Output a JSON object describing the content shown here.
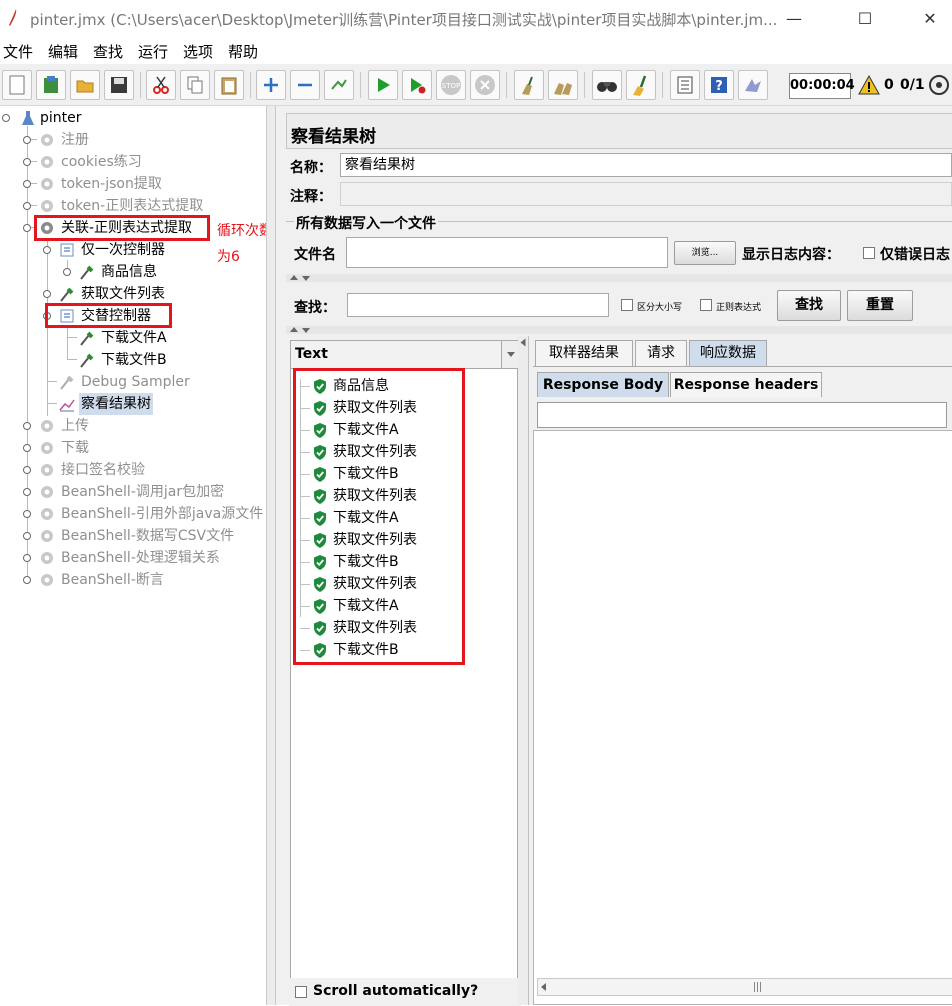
{
  "window": {
    "title": "pinter.jmx (C:\\Users\\acer\\Desktop\\Jmeter训练营\\Pinter项目接口测试实战\\pinter项目实战脚本\\pinter.jm...",
    "minimize": "—",
    "maximize": "☐",
    "close": "✕"
  },
  "menu": [
    "文件",
    "编辑",
    "查找",
    "运行",
    "选项",
    "帮助"
  ],
  "toolbar": {
    "timer": "00:00:04",
    "warning_count": "0",
    "threads": "0/1"
  },
  "tree": {
    "root": "pinter",
    "items": [
      {
        "label": "注册"
      },
      {
        "label": "cookies练习"
      },
      {
        "label": "token-json提取"
      },
      {
        "label": "token-正则表达式提取"
      },
      {
        "label": "关联-正则表达式提取"
      },
      {
        "label": "仅一次控制器"
      },
      {
        "label": "商品信息"
      },
      {
        "label": "获取文件列表"
      },
      {
        "label": "交替控制器"
      },
      {
        "label": "下载文件A"
      },
      {
        "label": "下载文件B"
      },
      {
        "label": "Debug Sampler"
      },
      {
        "label": "察看结果树"
      },
      {
        "label": "上传"
      },
      {
        "label": "下载"
      },
      {
        "label": "接口签名校验"
      },
      {
        "label": "BeanShell-调用jar包加密"
      },
      {
        "label": "BeanShell-引用外部java源文件"
      },
      {
        "label": "BeanShell-数据写CSV文件"
      },
      {
        "label": "BeanShell-处理逻辑关系"
      },
      {
        "label": "BeanShell-断言"
      }
    ],
    "annotation_line1": "循环次数",
    "annotation_line2": "为6"
  },
  "panel": {
    "title": "察看结果树",
    "name_label": "名称：",
    "name_value": "察看结果树",
    "comment_label": "注释：",
    "comment_value": "",
    "file_section_title": "所有数据写入一个文件",
    "filename_label": "文件名",
    "filename_value": "",
    "browse_button": "浏览...",
    "log_label": "显示日志内容：",
    "errors_only_label": "仅错误日志",
    "search_label": "查找：",
    "search_value": "",
    "case_sensitive_label": "区分大小写",
    "regex_label": "正则表达式",
    "find_button": "查找",
    "reset_button": "重置"
  },
  "results": {
    "renderer": "Text",
    "items": [
      "商品信息",
      "获取文件列表",
      "下载文件A",
      "获取文件列表",
      "下载文件B",
      "获取文件列表",
      "下载文件A",
      "获取文件列表",
      "下载文件B",
      "获取文件列表",
      "下载文件A",
      "获取文件列表",
      "下载文件B"
    ],
    "scroll_auto_label": "Scroll automatically?"
  },
  "tabs": [
    "取样器结果",
    "请求",
    "响应数据"
  ],
  "subtabs": [
    "Response Body",
    "Response headers"
  ],
  "colors": {
    "highlight_red": "#e4151c",
    "success_green": "#1e8a3c",
    "selected_tab": "#cfdceb"
  }
}
